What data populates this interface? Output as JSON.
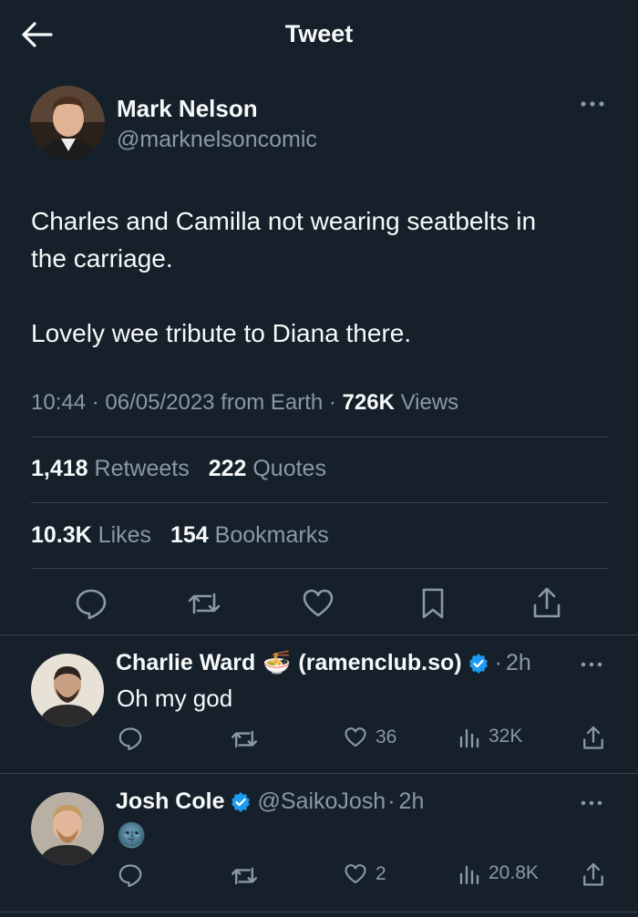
{
  "header": {
    "title": "Tweet"
  },
  "tweet": {
    "author_name": "Mark Nelson",
    "author_handle": "@marknelsoncomic",
    "text_line1": "Charles and Camilla not wearing seatbelts in",
    "text_line2": "the carriage.",
    "text_line3": "Lovely wee tribute to Diana there.",
    "time": "10:44",
    "date": "06/05/2023",
    "source": "from Earth",
    "views_count": "726K",
    "views_label": "Views",
    "retweets_count": "1,418",
    "retweets_label": "Retweets",
    "quotes_count": "222",
    "quotes_label": "Quotes",
    "likes_count": "10.3K",
    "likes_label": "Likes",
    "bookmarks_count": "154",
    "bookmarks_label": "Bookmarks"
  },
  "replies": [
    {
      "name": "Charlie Ward",
      "emoji": "🍜",
      "name_suffix": "(ramenclub.so)",
      "separator": "·",
      "time": "2h",
      "text": "Oh my god",
      "likes": "36",
      "views": "32K"
    },
    {
      "name": "Josh Cole",
      "handle": "@SaikoJosh",
      "separator": "·",
      "time": "2h",
      "text": "🌚",
      "likes": "2",
      "views": "20.8K"
    }
  ],
  "colors": {
    "background": "#15202b",
    "text": "#f7f9f9",
    "secondary_text": "#8b98a5",
    "divider": "#38444d",
    "verified": "#1d9bf0"
  },
  "icons": {
    "back": "arrow-left-icon",
    "more": "more-horizontal-icon",
    "reply": "reply-icon",
    "retweet": "retweet-icon",
    "like": "heart-icon",
    "bookmark": "bookmark-icon",
    "share": "share-icon",
    "views": "views-icon",
    "verified": "verified-badge-icon"
  }
}
